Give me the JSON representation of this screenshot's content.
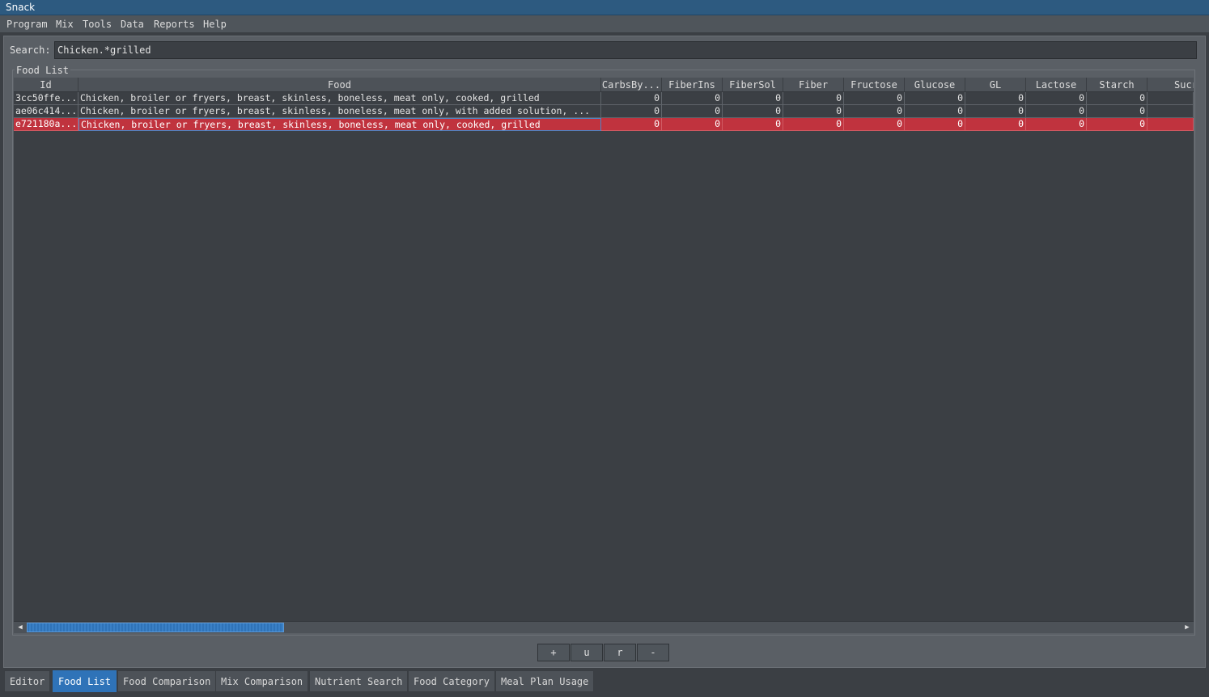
{
  "window": {
    "title": "Snack"
  },
  "menu": [
    "Program",
    "Mix",
    "Tools",
    "Data",
    "Reports",
    "Help"
  ],
  "search": {
    "label": "Search:",
    "value": "Chicken.*grilled"
  },
  "group": {
    "title": "Food List"
  },
  "table": {
    "columns": [
      "Id",
      "Food",
      "CarbsBy...",
      "FiberIns",
      "FiberSol",
      "Fiber",
      "Fructose",
      "Glucose",
      "GL",
      "Lactose",
      "Starch",
      "Sucros"
    ],
    "rows": [
      {
        "id": "3cc50ffe...",
        "food": "Chicken, broiler or fryers, breast, skinless, boneless, meat only, cooked, grilled",
        "values": [
          "0",
          "0",
          "0",
          "0",
          "0",
          "0",
          "0",
          "0",
          "0"
        ],
        "sucros": ""
      },
      {
        "id": "ae06c414...",
        "food": "Chicken, broiler or fryers, breast, skinless, boneless, meat only, with added solution, ...",
        "values": [
          "0",
          "0",
          "0",
          "0",
          "0",
          "0",
          "0",
          "0",
          "0"
        ],
        "sucros": ""
      },
      {
        "id": "e721180a...",
        "food": "Chicken, broiler or fryers, breast, skinless, boneless, meat only, cooked, grilled",
        "values": [
          "0",
          "0",
          "0",
          "0",
          "0",
          "0",
          "0",
          "0",
          "0"
        ],
        "sucros": "",
        "selected": true
      }
    ]
  },
  "buttons": {
    "add": "+",
    "update": "u",
    "refresh": "r",
    "remove": "-"
  },
  "tabs": [
    "Editor",
    "Food List",
    "Food Comparison",
    "Mix Comparison",
    "Nutrient Search",
    "Food Category",
    "Meal Plan Usage"
  ],
  "active_tab": "Food List",
  "colors": {
    "titlebar": "#2d5a80",
    "selection": "#c0333e",
    "accent": "#2f73b8",
    "background": "#3b3f44"
  }
}
